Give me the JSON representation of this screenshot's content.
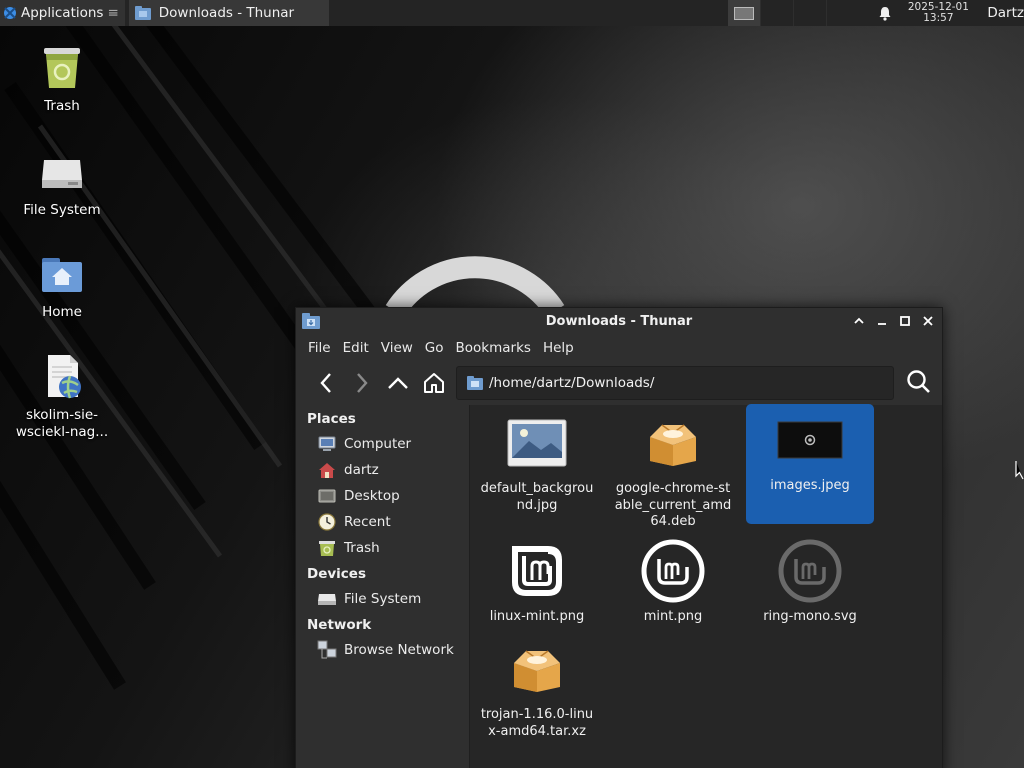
{
  "panel": {
    "apps_label": "Applications",
    "taskbar_window_title": "Downloads - Thunar",
    "clock_date": "2025-12-01",
    "clock_time": "13:57",
    "user": "Dartz"
  },
  "desktop": {
    "icons": [
      {
        "label": "Trash",
        "icon": "trash-full-icon"
      },
      {
        "label": "File System",
        "icon": "drive-icon"
      },
      {
        "label": "Home",
        "icon": "home-folder-icon"
      },
      {
        "label_line1": "skolim-sie-",
        "label_line2": "wsciekl-nag...",
        "icon": "html-file-icon"
      }
    ]
  },
  "window": {
    "title": "Downloads - Thunar",
    "menu": [
      "File",
      "Edit",
      "View",
      "Go",
      "Bookmarks",
      "Help"
    ],
    "location": "/home/dartz/Downloads/",
    "sidebar": {
      "places_heading": "Places",
      "places": [
        "Computer",
        "dartz",
        "Desktop",
        "Recent",
        "Trash"
      ],
      "devices_heading": "Devices",
      "devices": [
        "File System"
      ],
      "network_heading": "Network",
      "network": [
        "Browse Network"
      ]
    },
    "files": [
      {
        "name": "default_background.jpg",
        "icon": "image-thumbnail-icon",
        "selected": false
      },
      {
        "name": "google-chrome-stable_current_amd64.deb",
        "icon": "package-icon",
        "selected": false
      },
      {
        "name": "images.jpeg",
        "icon": "image-thumbnail-icon",
        "selected": true
      },
      {
        "name": "linux-mint.png",
        "icon": "mint-logo-icon",
        "selected": false
      },
      {
        "name": "mint.png",
        "icon": "mint-ring-icon",
        "selected": false
      },
      {
        "name": "ring-mono.svg",
        "icon": "mint-ring-mono-icon",
        "selected": false
      },
      {
        "name": "trojan-1.16.0-linux-amd64.tar.xz",
        "icon": "package-icon",
        "selected": false
      }
    ]
  },
  "colors": {
    "selection": "#1b5fb0",
    "panel_bg": "#242424",
    "window_bg": "#2b2b2b",
    "file_view_bg": "#262626"
  }
}
